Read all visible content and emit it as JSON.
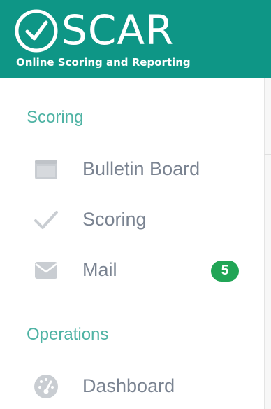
{
  "brand": {
    "logo_word": "SCAR",
    "tagline": "Online Scoring and Reporting",
    "color": "#0e9686"
  },
  "sections": [
    {
      "title": "Scoring",
      "items": [
        {
          "label": "Bulletin Board",
          "icon": "bulletin-board-icon"
        },
        {
          "label": "Scoring",
          "icon": "checkmark-icon"
        },
        {
          "label": "Mail",
          "icon": "mail-icon",
          "badge": "5"
        }
      ]
    },
    {
      "title": "Operations",
      "items": [
        {
          "label": "Dashboard",
          "icon": "dashboard-gauge-icon"
        }
      ]
    }
  ],
  "colors": {
    "section_title": "#4fb3a4",
    "nav_label": "#7a8391",
    "icon": "#c9cdd2",
    "badge": "#21a556"
  }
}
